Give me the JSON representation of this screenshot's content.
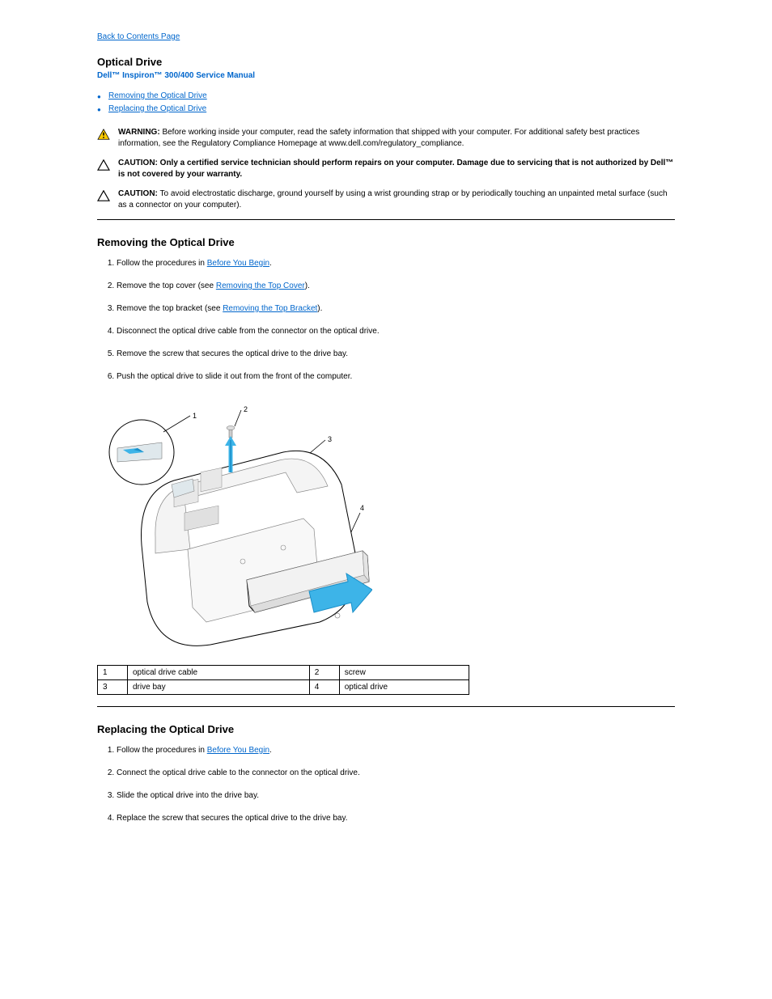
{
  "back_link": "Back to Contents Page",
  "page_title": "Optical Drive",
  "subtitle": "Dell™ Inspiron™ 300/400 Service Manual",
  "bullets": [
    {
      "label": "Removing the Optical Drive"
    },
    {
      "label": "Replacing the Optical Drive"
    }
  ],
  "warning": {
    "label": "WARNING:",
    "text": "Before working inside your computer, read the safety information that shipped with your computer. For additional safety best practices information, see the Regulatory Compliance Homepage at www.dell.com/regulatory_compliance."
  },
  "caution1": {
    "label": "CAUTION:",
    "prefix": "Only a certified service technician should perform repairs on your computer. Damage due to servicing that is not authorized by Dell™",
    "suffix": "is not covered by your warranty."
  },
  "caution2": {
    "label": "CAUTION:",
    "text": "To avoid electrostatic discharge, ground yourself by using a wrist grounding strap or by periodically touching an unpainted metal surface (such as a connector on your computer)."
  },
  "section1": {
    "heading": "Removing the Optical Drive",
    "steps": [
      {
        "pre": "Follow the procedures in ",
        "link": "Before You Begin",
        "post": "."
      },
      {
        "pre": "Remove the top cover (see ",
        "link": "Removing the Top Cover",
        "post": ")."
      },
      {
        "pre": "Remove the top bracket (see ",
        "link": "Removing the Top Bracket",
        "post": ")."
      },
      {
        "pre": "Disconnect the optical drive cable from the connector on the optical drive.",
        "link": "",
        "post": ""
      },
      {
        "pre": "Remove the screw that secures the optical drive to the drive bay.",
        "link": "",
        "post": ""
      },
      {
        "pre": "Push the optical drive to slide it out from the front of the computer.",
        "link": "",
        "post": ""
      }
    ]
  },
  "parts": [
    {
      "num": "1",
      "label": "optical drive cable",
      "num2": "2",
      "label2": "screw"
    },
    {
      "num": "3",
      "label": "drive bay",
      "num2": "4",
      "label2": "optical drive"
    }
  ],
  "section2": {
    "heading": "Replacing the Optical Drive",
    "steps": [
      {
        "pre": "Follow the procedures in ",
        "link": "Before You Begin",
        "post": "."
      },
      {
        "pre": "Connect the optical drive cable to the connector on the optical drive.",
        "link": "",
        "post": ""
      },
      {
        "pre": "Slide the optical drive into the drive bay.",
        "link": "",
        "post": ""
      },
      {
        "pre": "Replace the screw that secures the optical drive to the drive bay.",
        "link": "",
        "post": ""
      }
    ]
  }
}
